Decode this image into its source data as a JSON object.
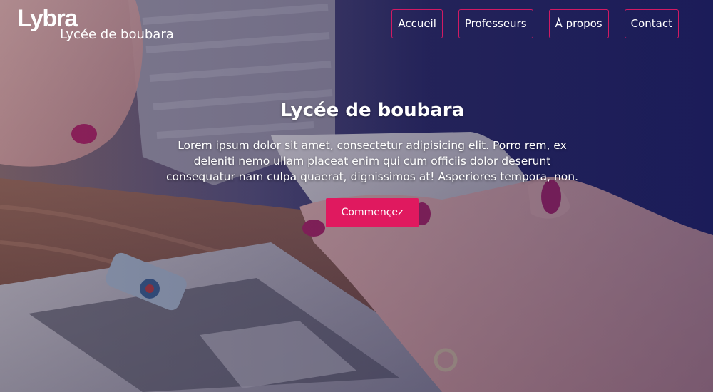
{
  "brand": {
    "logo": "Lybra",
    "subtitle": "Lycée de boubara"
  },
  "nav": {
    "items": [
      {
        "label": "Accueil"
      },
      {
        "label": "Professeurs"
      },
      {
        "label": "À propos"
      },
      {
        "label": "Contact"
      }
    ]
  },
  "hero": {
    "title": "Lycée de boubara",
    "description": "Lorem ipsum dolor sit amet, consectetur adipisicing elit. Porro rem, ex deleniti nemo ullam placeat enim qui cum officiis dolor deserunt consequatur nam culpa quaerat, dignissimos at! Asperiores tempora, non.",
    "cta_label": "Commençez"
  },
  "colors": {
    "accent": "#e0195f",
    "nav_border": "#d21a63",
    "text": "#ffffff"
  }
}
